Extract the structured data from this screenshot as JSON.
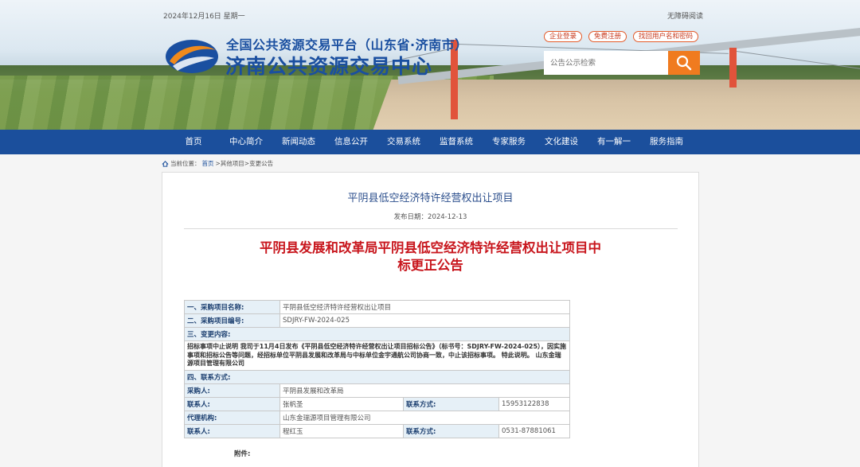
{
  "header": {
    "date_line": "2024年12月16日 星期一",
    "accessible_label": "无障碍阅读",
    "platform_title": "全国公共资源交易平台（山东省·济南市）",
    "center_title": "济南公共资源交易中心",
    "buttons": [
      "企业登录",
      "免费注册",
      "找回用户名和密码"
    ],
    "search_placeholder": "公告公示检索"
  },
  "nav": {
    "items": [
      "首页",
      "中心简介",
      "新闻动态",
      "信息公开",
      "交易系统",
      "监督系统",
      "专家服务",
      "文化建设",
      "有一解一",
      "服务指南"
    ]
  },
  "breadcrumb": {
    "current_label": "当前位置：",
    "home": "首页",
    "rest": ">其他项目>变更公告"
  },
  "article": {
    "page_title": "平阴县低空经济特许经营权出让项目",
    "publish_date": "发布日期：2024-12-13",
    "headline_line1": "平阴县发展和改革局平阴县低空经济特许经营权出让项目中",
    "headline_line2": "标更正公告",
    "table": {
      "r1_label": "一、采购项目名称:",
      "r1_value": "平阴县低空经济特许经营权出让项目",
      "r2_label": "二、采购项目编号:",
      "r2_value": "SDJRY-FW-2024-025",
      "r3_section": "三、变更内容:",
      "r3_text": "招标事项中止说明 我司于11月4日发布《平阴县低空经济特许经营权出让项目招标公告》（标书号：SDJRY-FW-2024-025），因实施事项和招标公告等问题，经招标单位平阴县发展和改革局与中标单位金宇通航公司协商一致，中止该招标事项。 特此说明。 山东金瑞源项目管理有限公司",
      "r4_section": "四、联系方式:",
      "buyer_label": "采购人:",
      "buyer_value": "平阴县发展和改革局",
      "contact1_label": "联系人:",
      "contact1_value": "张帆圣",
      "phone1_label": "联系方式:",
      "phone1_value": "15953122838",
      "agency_label": "代理机构:",
      "agency_value": "山东金瑞源项目管理有限公司",
      "contact2_label": "联系人:",
      "contact2_value": "程红玉",
      "phone2_label": "联系方式:",
      "phone2_value": "0531-87881061"
    },
    "attachment_label": "附件:"
  },
  "colors": {
    "nav_bg": "#1b4f9c",
    "title_blue": "#1a4fa0",
    "headline_red": "#c8161d",
    "search_orange": "#f07b1f"
  }
}
